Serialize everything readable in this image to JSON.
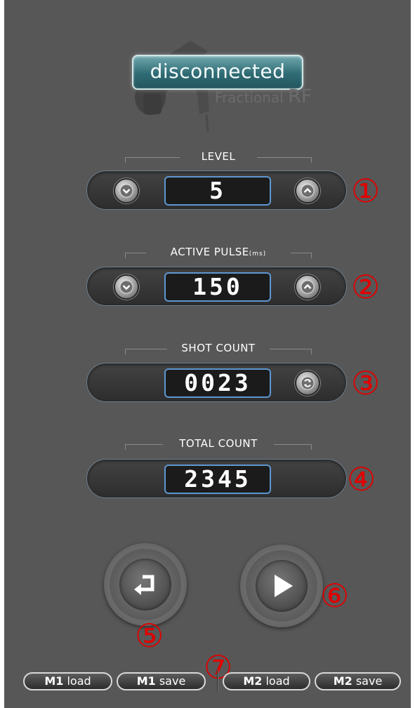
{
  "status": {
    "text": "disconnected"
  },
  "brand": {
    "prefix": "Fractional ",
    "suffix": "RF"
  },
  "level": {
    "label": "LEVEL",
    "value": "5",
    "marker": "①"
  },
  "active_pulse": {
    "label": "ACTIVE PULSE",
    "unit": "(ms)",
    "value": "150",
    "marker": "②"
  },
  "shot_count": {
    "label": "SHOT COUNT",
    "value": "0023",
    "marker": "③"
  },
  "total_count": {
    "label": "TOTAL COUNT",
    "value": "2345",
    "marker": "④"
  },
  "controls": {
    "back_marker": "⑤",
    "start_marker": "⑥",
    "memory_marker": "⑦"
  },
  "memory": {
    "m1_load": {
      "slot": "M1",
      "action": "load"
    },
    "m1_save": {
      "slot": "M1",
      "action": "save"
    },
    "m2_load": {
      "slot": "M2",
      "action": "load"
    },
    "m2_save": {
      "slot": "M2",
      "action": "save"
    }
  },
  "icons": {
    "decrease": "chevron-down-icon",
    "increase": "chevron-up-icon",
    "reset": "refresh-icon",
    "back": "return-arrow-icon",
    "start": "play-icon"
  },
  "colors": {
    "background": "#575757",
    "accent": "#5d97d2",
    "status": "#2f6b74",
    "marker": "#e00000"
  }
}
